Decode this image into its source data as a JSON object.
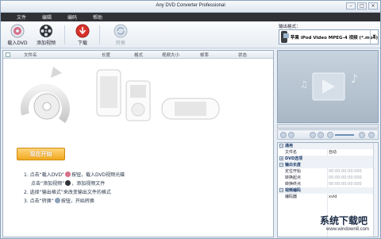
{
  "window": {
    "title": "Any DVD Converter Professional",
    "buttons": [
      "–",
      "□",
      "×"
    ]
  },
  "menu": [
    "文件",
    "编辑",
    "编码",
    "帮助"
  ],
  "toolbar": {
    "load_dvd": "载入DVD",
    "add_video": "添加视频",
    "download": "下载",
    "convert": "转换"
  },
  "output_format": {
    "label": "输出格式：",
    "value": "苹果 iPod Video MPEG-4 视频 (*.mp4)"
  },
  "table": {
    "columns": [
      "文件名",
      "长度",
      "格式",
      "视频大小",
      "帧率",
      "状态"
    ]
  },
  "start_button": "现在开始",
  "steps": [
    {
      "prefix": "1. 点击“载入DVD”",
      "suffix": "按钮，载入DVD视频光碟"
    },
    {
      "prefix": "点击“添加视频”",
      "suffix": "，添加视频文件"
    },
    {
      "prefix": "2. 选择“输出格式”来改变输出文件的格式",
      "suffix": ""
    },
    {
      "prefix": "3. 点击“转换”",
      "suffix": "按钮，开始转换"
    }
  ],
  "properties": [
    {
      "type": "group",
      "key": "通用",
      "toggle": "−"
    },
    {
      "type": "row",
      "key": "文件名",
      "value": "自动"
    },
    {
      "type": "group",
      "key": "DVD选项",
      "toggle": "+"
    },
    {
      "type": "group",
      "key": "输出长度",
      "toggle": "−"
    },
    {
      "type": "row",
      "key": "定位开始",
      "value": "00:00:00:00:000",
      "dim": true
    },
    {
      "type": "row",
      "key": "转换起点",
      "value": "00:00:00:00:000",
      "dim": true
    },
    {
      "type": "row",
      "key": "转换终点",
      "value": "00:00:00:00:000",
      "dim": true
    },
    {
      "type": "group",
      "key": "视频编码",
      "toggle": "−"
    },
    {
      "type": "row",
      "key": "编码器",
      "value": "xvid"
    }
  ],
  "watermark": {
    "title": "系统下载吧",
    "url": "www.windown8.com"
  },
  "colors": {
    "menubar": "#2f3135",
    "start_button": "#f0a820",
    "group_text": "#1f3c6a"
  }
}
